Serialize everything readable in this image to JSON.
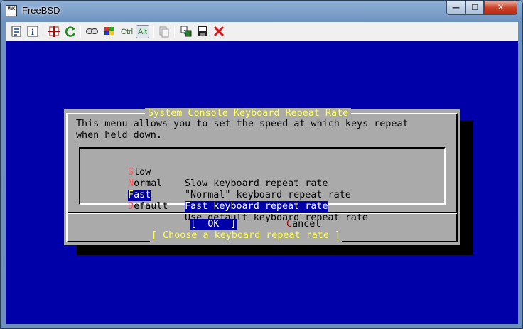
{
  "window": {
    "title": "FreeBSD",
    "app_icon_text": "VNC",
    "minimize_glyph": "—",
    "maximize_glyph": "☐",
    "close_glyph": "✕"
  },
  "toolbar": {
    "items": [
      "options-icon",
      "info-icon",
      "fullscreen-icon",
      "refresh-icon",
      "ctrl-alt-del-icon",
      "windows-key-icon"
    ],
    "ctrl_label": "Ctrl",
    "alt_label": "Alt",
    "alt_active": true,
    "tools": [
      "clipboard-icon",
      "transfer-icon",
      "save-icon",
      "disconnect-icon"
    ]
  },
  "dialog": {
    "title": "System Console Keyboard Repeat Rate",
    "prompt_line1": "This menu allows you to set the speed at which keys repeat",
    "prompt_line2": "when held down.",
    "menu": [
      {
        "hot": "S",
        "rest": "low",
        "desc": "Slow keyboard repeat rate",
        "selected": false
      },
      {
        "hot": "N",
        "rest": "ormal",
        "desc": "\"Normal\" keyboard repeat rate",
        "selected": false
      },
      {
        "hot": "F",
        "rest": "ast",
        "desc": "Fast keyboard repeat rate",
        "selected": true
      },
      {
        "hot": "D",
        "rest": "efault",
        "desc": "Use default keyboard repeat rate",
        "selected": false
      }
    ],
    "ok_button": {
      "open": "[  ",
      "hot": "O",
      "rest": "K",
      "close": "  ]"
    },
    "cancel_button": {
      "hot": "C",
      "rest": "ancel"
    },
    "hint": "[ Choose a keyboard repeat rate ]"
  },
  "colors": {
    "console_bg": "#0000a8",
    "dialog_bg": "#aaaaaa",
    "title_yellow": "#ffff55",
    "hotkey_red": "#ff5555"
  }
}
